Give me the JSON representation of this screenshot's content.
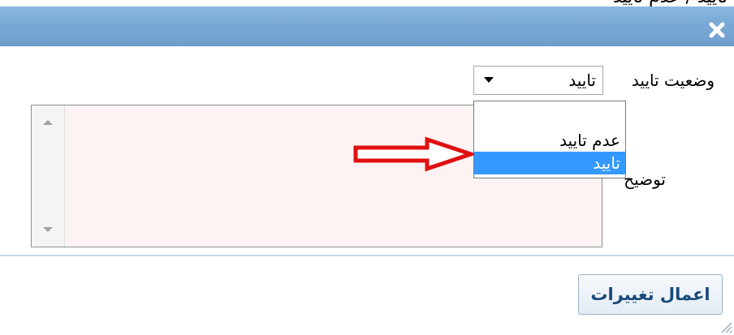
{
  "dialog": {
    "top_clipped_text": "تایید / عدم تایید",
    "close_icon": "close-icon",
    "colors": {
      "titlebar": "#7aaad6",
      "selection": "#3399ff",
      "annotation_arrow": "#e01010"
    }
  },
  "form": {
    "status_label": "وضعیت تایید",
    "status_value": "تایید",
    "status_options": [
      "",
      "عدم تایید",
      "تایید"
    ],
    "selected_option_index": 2,
    "description_label": "توضیح",
    "description_value": ""
  },
  "footer": {
    "apply_button": "اعمال تغییرات"
  }
}
